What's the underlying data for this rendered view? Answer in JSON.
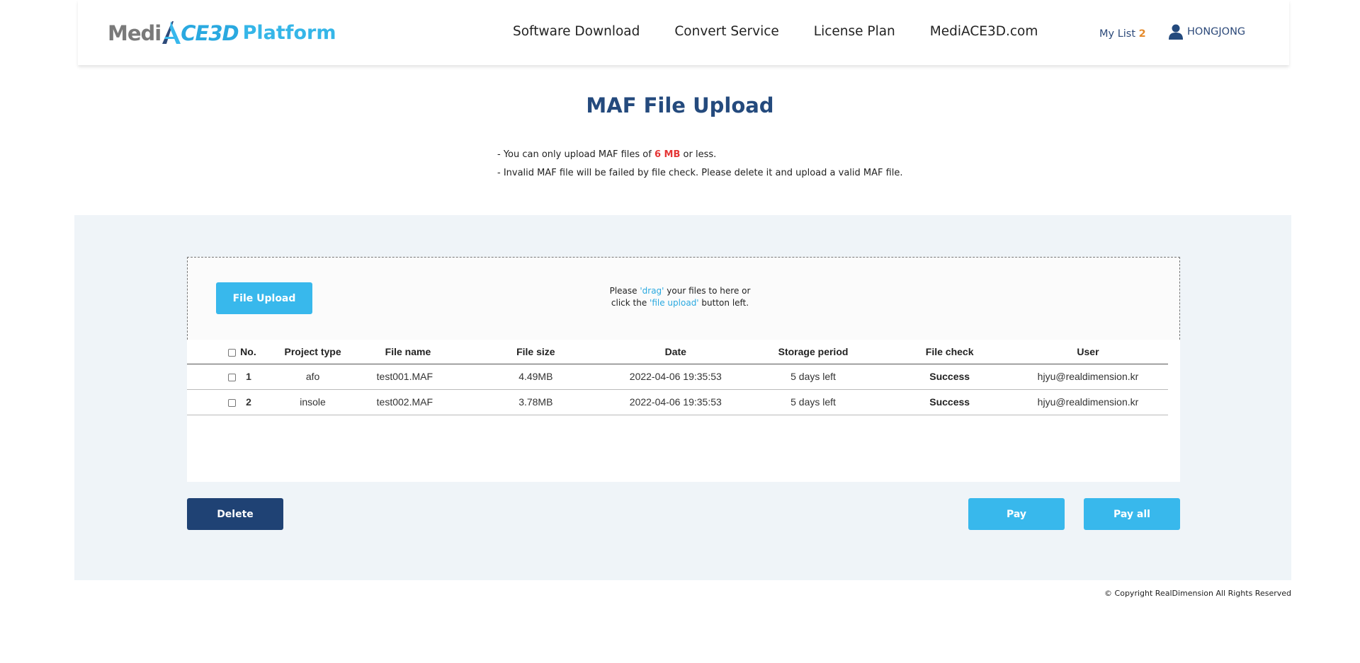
{
  "header": {
    "logo": {
      "part1": "Medi",
      "part2": "CE3D",
      "part3": "Platform"
    },
    "nav": [
      "Software Download",
      "Convert Service",
      "License Plan",
      "MediACE3D.com"
    ],
    "my_list_label": "My List",
    "my_list_count": "2",
    "user_name": "HONGJONG",
    "user_icon": "user-icon"
  },
  "page": {
    "title": "MAF File Upload",
    "note1_prefix": "- You can only upload MAF files of ",
    "note1_highlight": "6 MB",
    "note1_suffix": " or less.",
    "note2": "- Invalid MAF file will be failed by file check. Please delete it and upload a valid MAF file."
  },
  "upload": {
    "button": "File Upload",
    "hint_1a": "Please ",
    "hint_1b": "'drag'",
    "hint_1c": " your files to here or",
    "hint_2a": "click the ",
    "hint_2b": "'file upload'",
    "hint_2c": " button left."
  },
  "table": {
    "headers": {
      "no": "No.",
      "type": "Project type",
      "name": "File name",
      "size": "File size",
      "date": "Date",
      "storage": "Storage period",
      "check": "File check",
      "user": "User"
    },
    "rows": [
      {
        "no": "1",
        "type": "afo",
        "name": "test001.MAF",
        "size": "4.49MB",
        "date": "2022-04-06 19:35:53",
        "storage": "5 days left",
        "check": "Success",
        "user": "hjyu@realdimension.kr"
      },
      {
        "no": "2",
        "type": "insole",
        "name": "test002.MAF",
        "size": "3.78MB",
        "date": "2022-04-06 19:35:53",
        "storage": "5 days left",
        "check": "Success",
        "user": "hjyu@realdimension.kr"
      }
    ]
  },
  "actions": {
    "delete": "Delete",
    "pay": "Pay",
    "pay_all": "Pay all"
  },
  "footer": {
    "copyright": "© Copyright RealDimension All Rights Reserved"
  },
  "colors": {
    "brand_blue": "#38b8ec",
    "navy": "#1f4274",
    "title": "#244a7d",
    "panel_bg": "#eff4f8",
    "highlight_red": "#e53636"
  }
}
